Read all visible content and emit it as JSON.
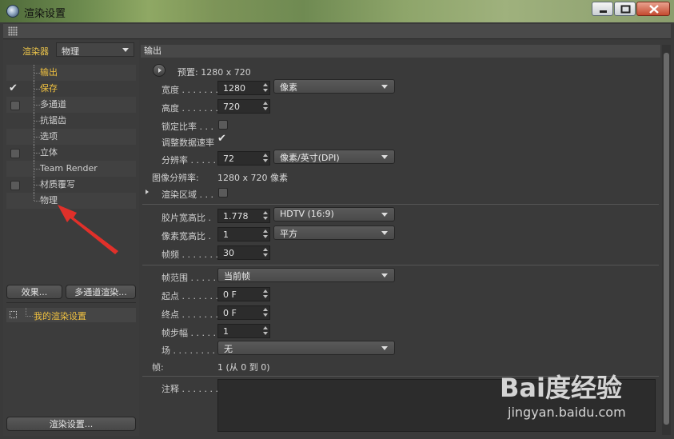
{
  "window": {
    "title": "渲染设置"
  },
  "left_panel": {
    "renderer_label": "渲染器",
    "renderer_value": "物理",
    "tree_items": [
      {
        "label": "输出",
        "checked": null,
        "selected": true
      },
      {
        "label": "保存",
        "checked": true,
        "selected": true
      },
      {
        "label": "多通道",
        "checked": false,
        "selected": false
      },
      {
        "label": "抗锯齿",
        "checked": null,
        "selected": false
      },
      {
        "label": "选项",
        "checked": null,
        "selected": false
      },
      {
        "label": "立体",
        "checked": false,
        "selected": false
      },
      {
        "label": "Team Render",
        "checked": null,
        "selected": false
      },
      {
        "label": "材质覆写",
        "checked": false,
        "selected": false
      },
      {
        "label": "物理",
        "checked": null,
        "selected": false
      }
    ],
    "effects_button": "效果...",
    "multipass_button": "多通道渲染...",
    "preset_label": "我的渲染设置",
    "render_settings_button": "渲染设置..."
  },
  "main": {
    "section_title": "输出",
    "preset": "预置: 1280 x 720",
    "width_label": "宽度 . . . . . . .",
    "width_value": "1280",
    "width_unit": "像素",
    "height_label": "高度 . . . . . . .",
    "height_value": "720",
    "lock_ratio_label": "锁定比率 . . .",
    "adapt_data_rate_label": "调整数据速率",
    "resolution_label": "分辨率 . . . . .",
    "resolution_value": "72",
    "resolution_unit": "像素/英寸(DPI)",
    "image_resolution_label": "图像分辨率:",
    "image_resolution_value": "1280 x 720 像素",
    "render_region_label": "渲染区域 . . .",
    "film_aspect_label": "胶片宽高比 .",
    "film_aspect_value": "1.778",
    "film_aspect_preset": "HDTV (16:9)",
    "pixel_aspect_label": "像素宽高比 .",
    "pixel_aspect_value": "1",
    "pixel_aspect_preset": "平方",
    "frame_rate_label": "帧频 . . . . . . .",
    "frame_rate_value": "30",
    "frame_range_label": "帧范围 . . . . .",
    "frame_range_value": "当前帧",
    "start_label": "起点 . . . . . . .",
    "start_value": "0 F",
    "end_label": "终点 . . . . . . .",
    "end_value": "0 F",
    "frame_step_label": "帧步幅 . . . . .",
    "frame_step_value": "1",
    "fields_label": "场 . . . . . . . . .",
    "fields_value": "无",
    "frames_label": "帧:",
    "frames_value": "1 (从 0 到 0)",
    "notes_label": "注释 . . . . . . ."
  },
  "watermark": {
    "logo": "Bai度经验",
    "url": "jingyan.baidu.com"
  },
  "colors": {
    "accent": "#f0c140",
    "bg": "#3a3a3a"
  }
}
